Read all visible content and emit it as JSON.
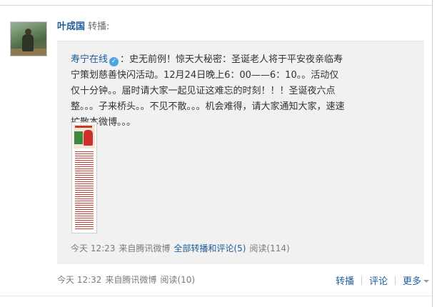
{
  "post": {
    "author": "叶成国",
    "action": "转播:",
    "footer": {
      "time": "今天 12:32",
      "source": "来自腾讯微博",
      "read": "阅读(10)"
    },
    "actions": {
      "repost": "转播",
      "comment": "评论",
      "more": "更多"
    }
  },
  "original": {
    "author": "寿宁在线",
    "text": "：史无前例！惊天大秘密：圣诞老人将于平安夜亲临寿宁策划慈善快闪活动。12月24日晚上6：00——6：10。。活动仅仅十分钟。。届时请大家一起见证这难忘的时刻！！！圣诞夜六点整。。。子来桥头。。不见不散。。。机会难得，请大家通知大家，速速扩散本微博。。。",
    "meta": {
      "time": "今天 12:23",
      "source": "来自腾讯微博",
      "all_link": "全部转播和评论(5)",
      "read": "阅读(114)"
    }
  },
  "icons": {
    "verified": "verified-badge-icon",
    "more_caret": "chevron-down-icon"
  },
  "colors": {
    "link": "#1f5d99",
    "muted": "#7a7a7a",
    "repost_bg": "#f1f1f1",
    "verified": "#4ea3e1"
  }
}
